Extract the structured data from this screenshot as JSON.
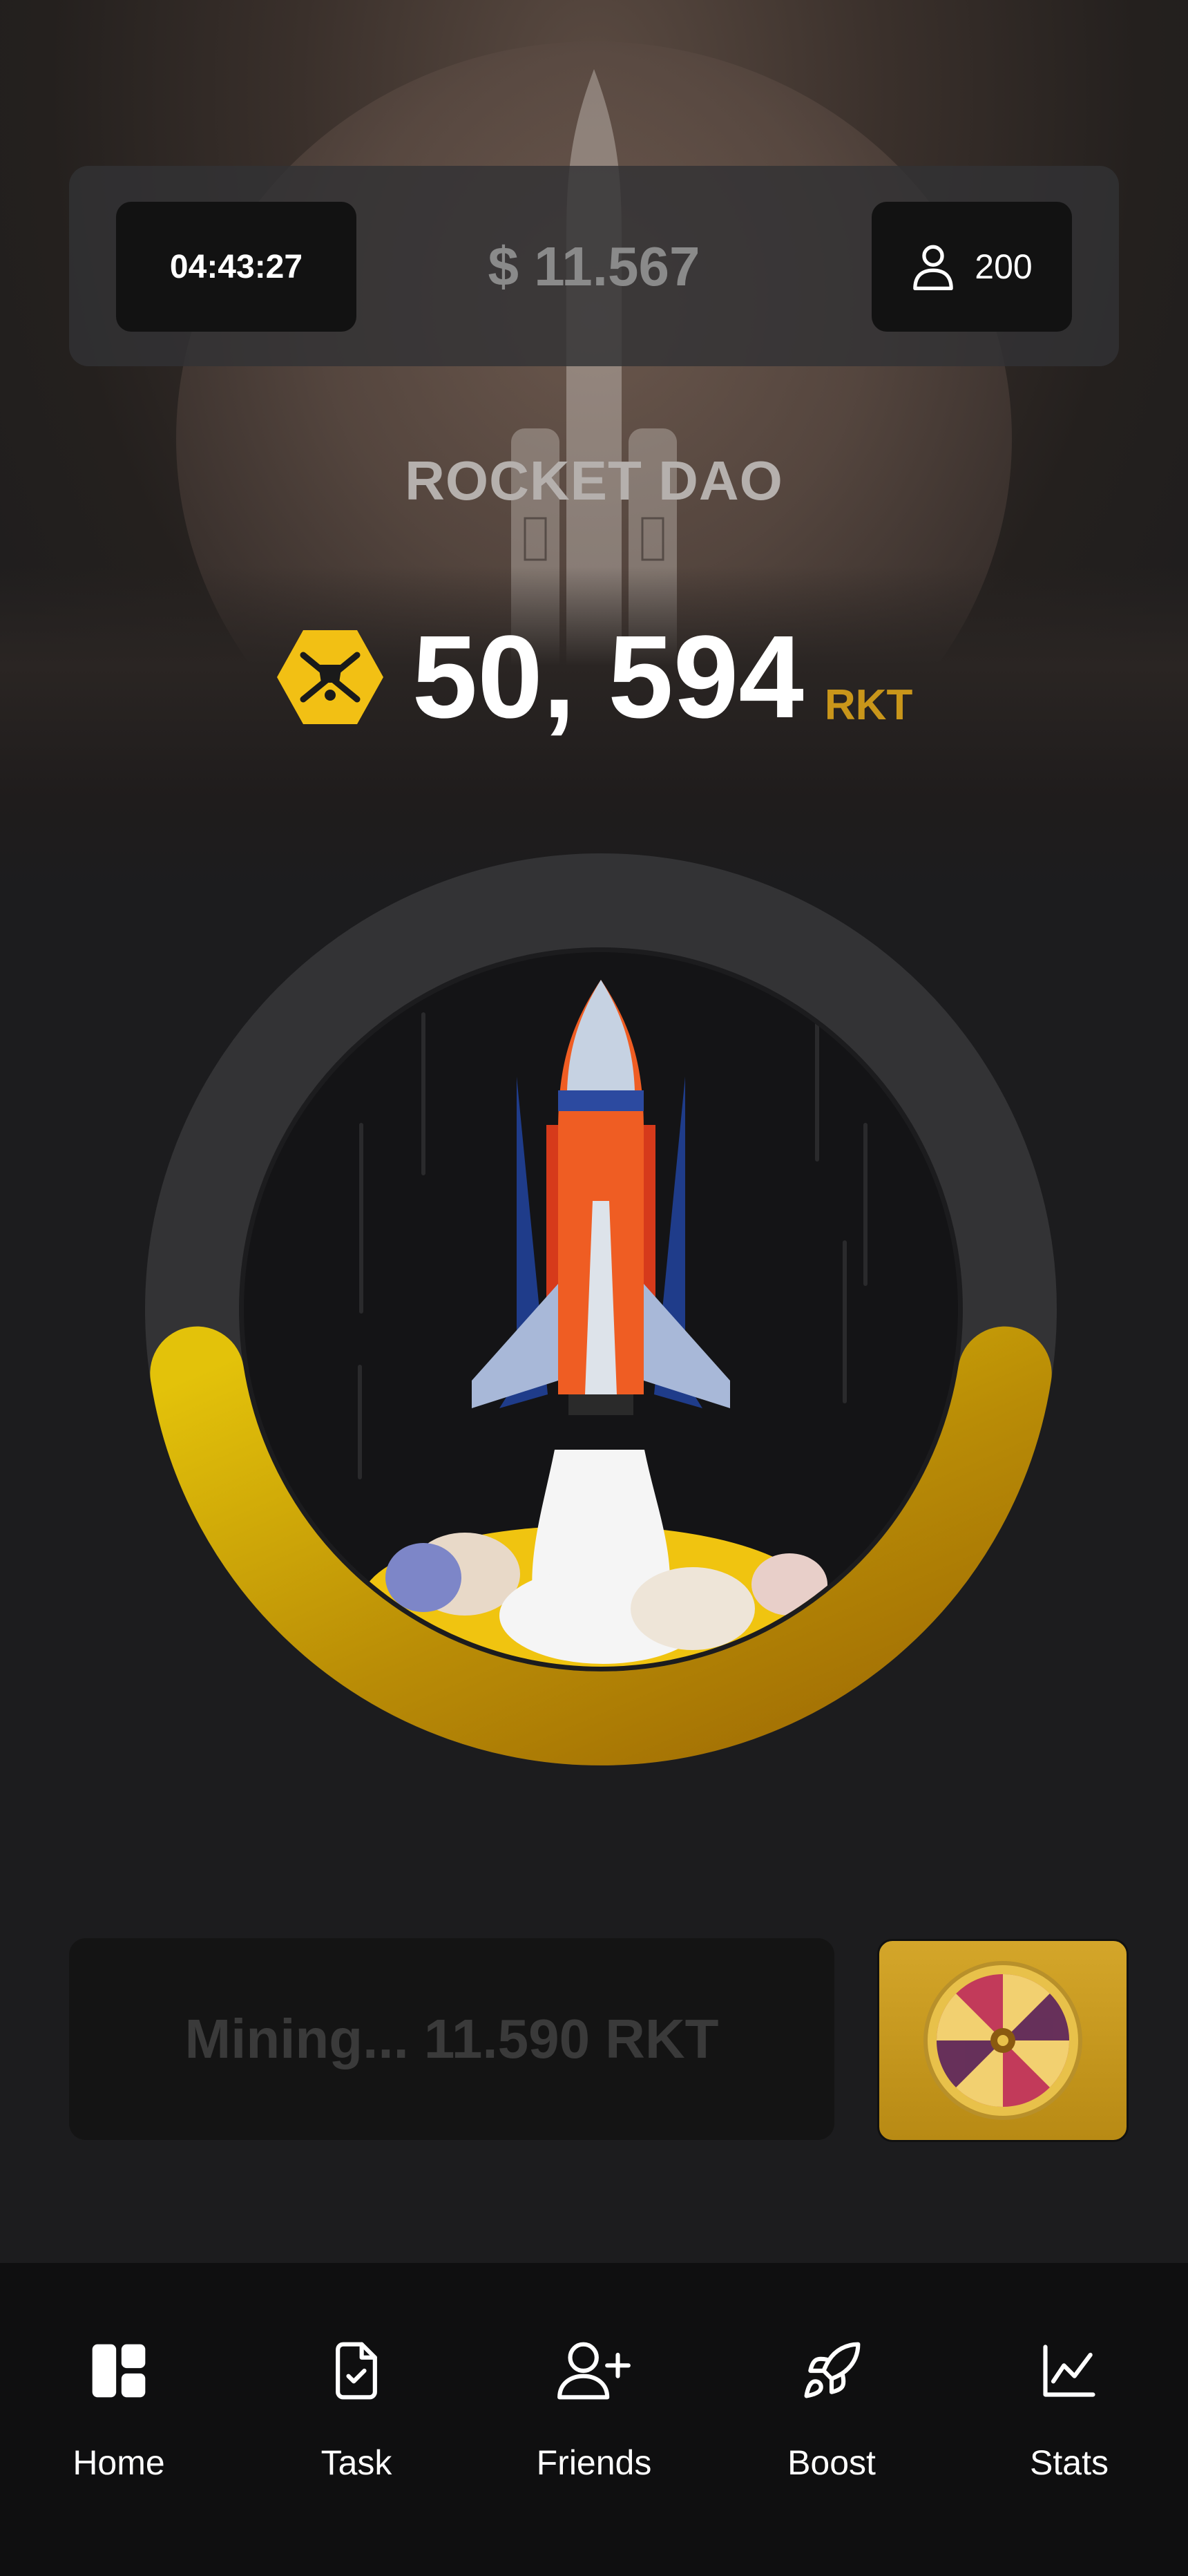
{
  "header": {
    "timer": "04:43:27",
    "balance": "$ 11.567",
    "friends_count": "200"
  },
  "brand": "ROCKET DAO",
  "score": {
    "value": "50, 594",
    "unit": "RKT"
  },
  "mining_progress": 0.45,
  "mining": {
    "label": "Mining...",
    "value": "11.590",
    "unit": "RKT"
  },
  "nav": {
    "items": [
      {
        "label": "Home",
        "icon": "dashboard-icon"
      },
      {
        "label": "Task",
        "icon": "file-check-icon"
      },
      {
        "label": "Friends",
        "icon": "user-plus-icon"
      },
      {
        "label": "Boost",
        "icon": "rocket-icon"
      },
      {
        "label": "Stats",
        "icon": "line-chart-icon"
      }
    ]
  },
  "colors": {
    "accent": "#e3b80d",
    "ring_track": "#333335",
    "background": "#1c1c1e"
  }
}
